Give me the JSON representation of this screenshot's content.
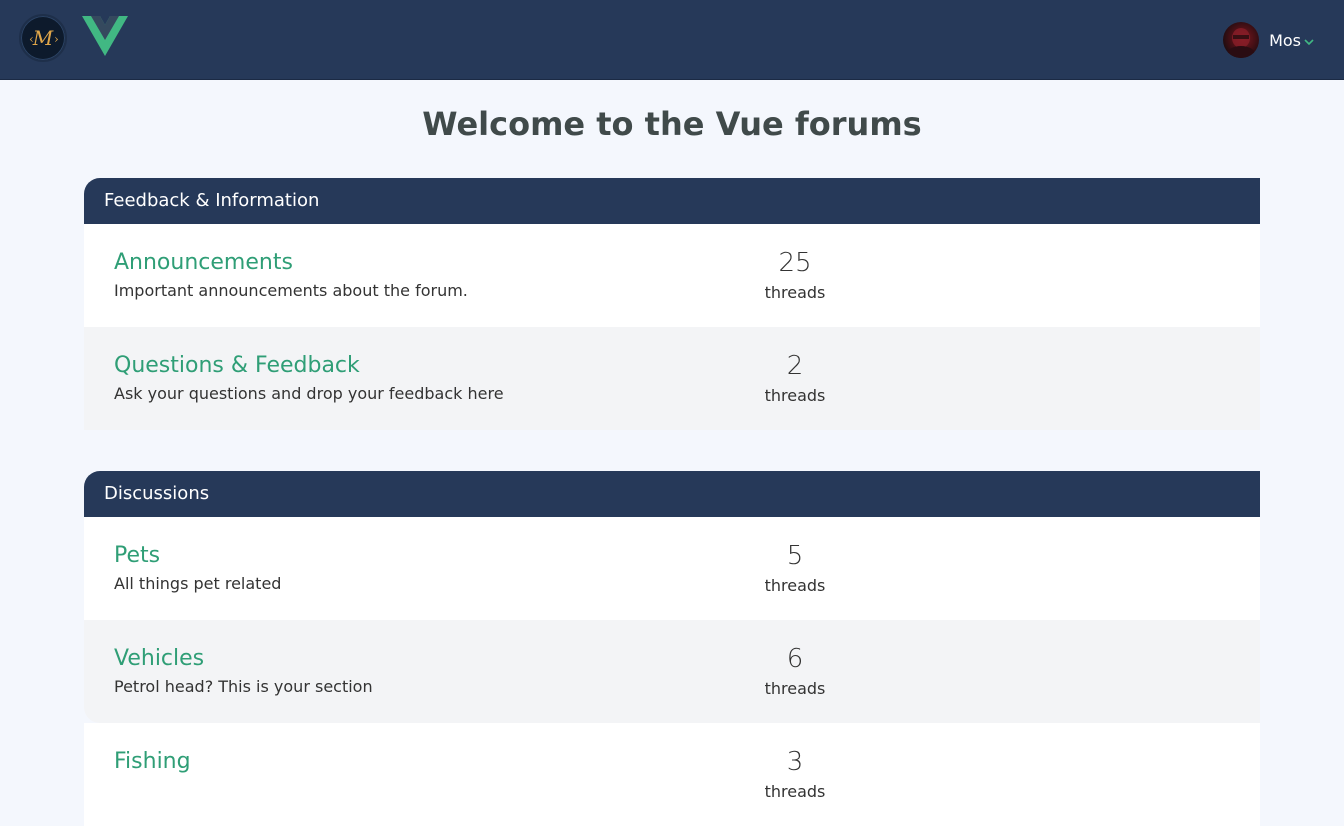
{
  "header": {
    "logo_text": "M",
    "username": "Mos",
    "colors": {
      "bar": "#263959",
      "vue_green": "#41b883",
      "vue_dark": "#35495e"
    }
  },
  "page": {
    "title": "Welcome to the Vue forums"
  },
  "categories": [
    {
      "name": "Feedback & Information",
      "forums": [
        {
          "name": "Announcements",
          "description": "Important announcements about the forum.",
          "threads": "25",
          "threads_label": "threads"
        },
        {
          "name": "Questions & Feedback",
          "description": "Ask your questions and drop your feedback here",
          "threads": "2",
          "threads_label": "threads"
        }
      ]
    },
    {
      "name": "Discussions",
      "forums": [
        {
          "name": "Pets",
          "description": "All things pet related",
          "threads": "5",
          "threads_label": "threads"
        },
        {
          "name": "Vehicles",
          "description": "Petrol head? This is your section",
          "threads": "6",
          "threads_label": "threads"
        },
        {
          "name": "Fishing",
          "description": "",
          "threads": "3",
          "threads_label": "threads"
        }
      ]
    }
  ],
  "icons": {
    "site_logo": "monogram-logo-icon",
    "vue_logo": "vue-logo-icon",
    "caret": "chevron-down-icon"
  }
}
